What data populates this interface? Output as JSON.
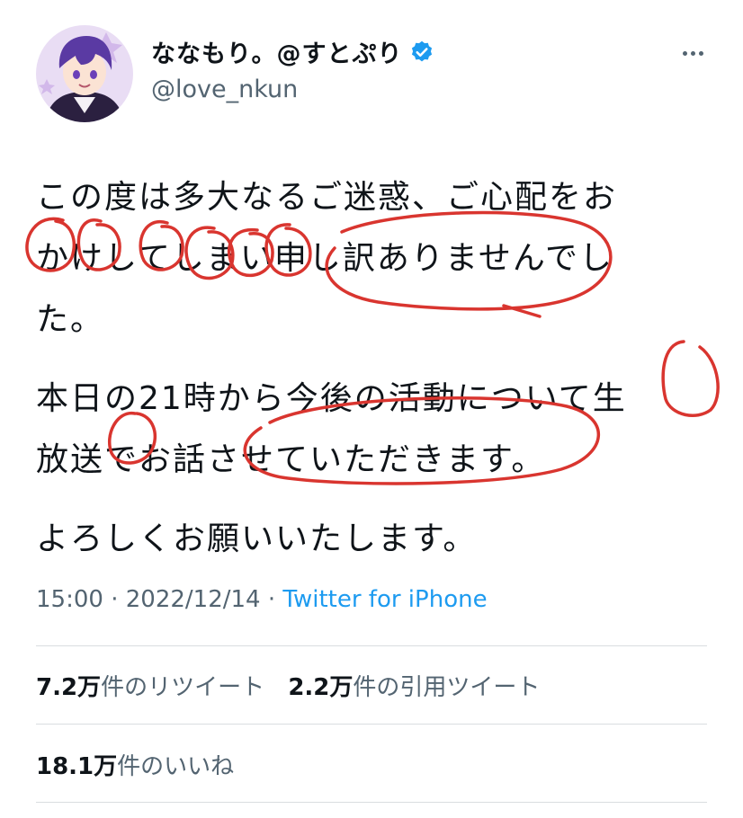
{
  "author": {
    "display_name": "ななもり。@すとぷり",
    "handle": "@love_nkun",
    "verified_color": "#1d9bf0"
  },
  "tweet": {
    "paragraphs": [
      "この度は多大なるご迷惑、ご心配をお\nかけしてしまい申し訳ありませんでし\nた。",
      "本日の21時から今後の活動について生\n放送でお話させていただきます。",
      "よろしくお願いいたします。"
    ],
    "time": "15:00",
    "date": "2022/12/14",
    "separator": "·",
    "source": "Twitter for iPhone"
  },
  "stats": {
    "retweets_count": "7.2万",
    "retweets_label": "件のリツイート",
    "quotes_count": "2.2万",
    "quotes_label": "件の引用ツイート",
    "likes_count": "18.1万",
    "likes_label": "件のいいね"
  },
  "colors": {
    "annotation_red": "#d9352f",
    "link_blue": "#1d9bf0",
    "secondary_text": "#536471"
  }
}
